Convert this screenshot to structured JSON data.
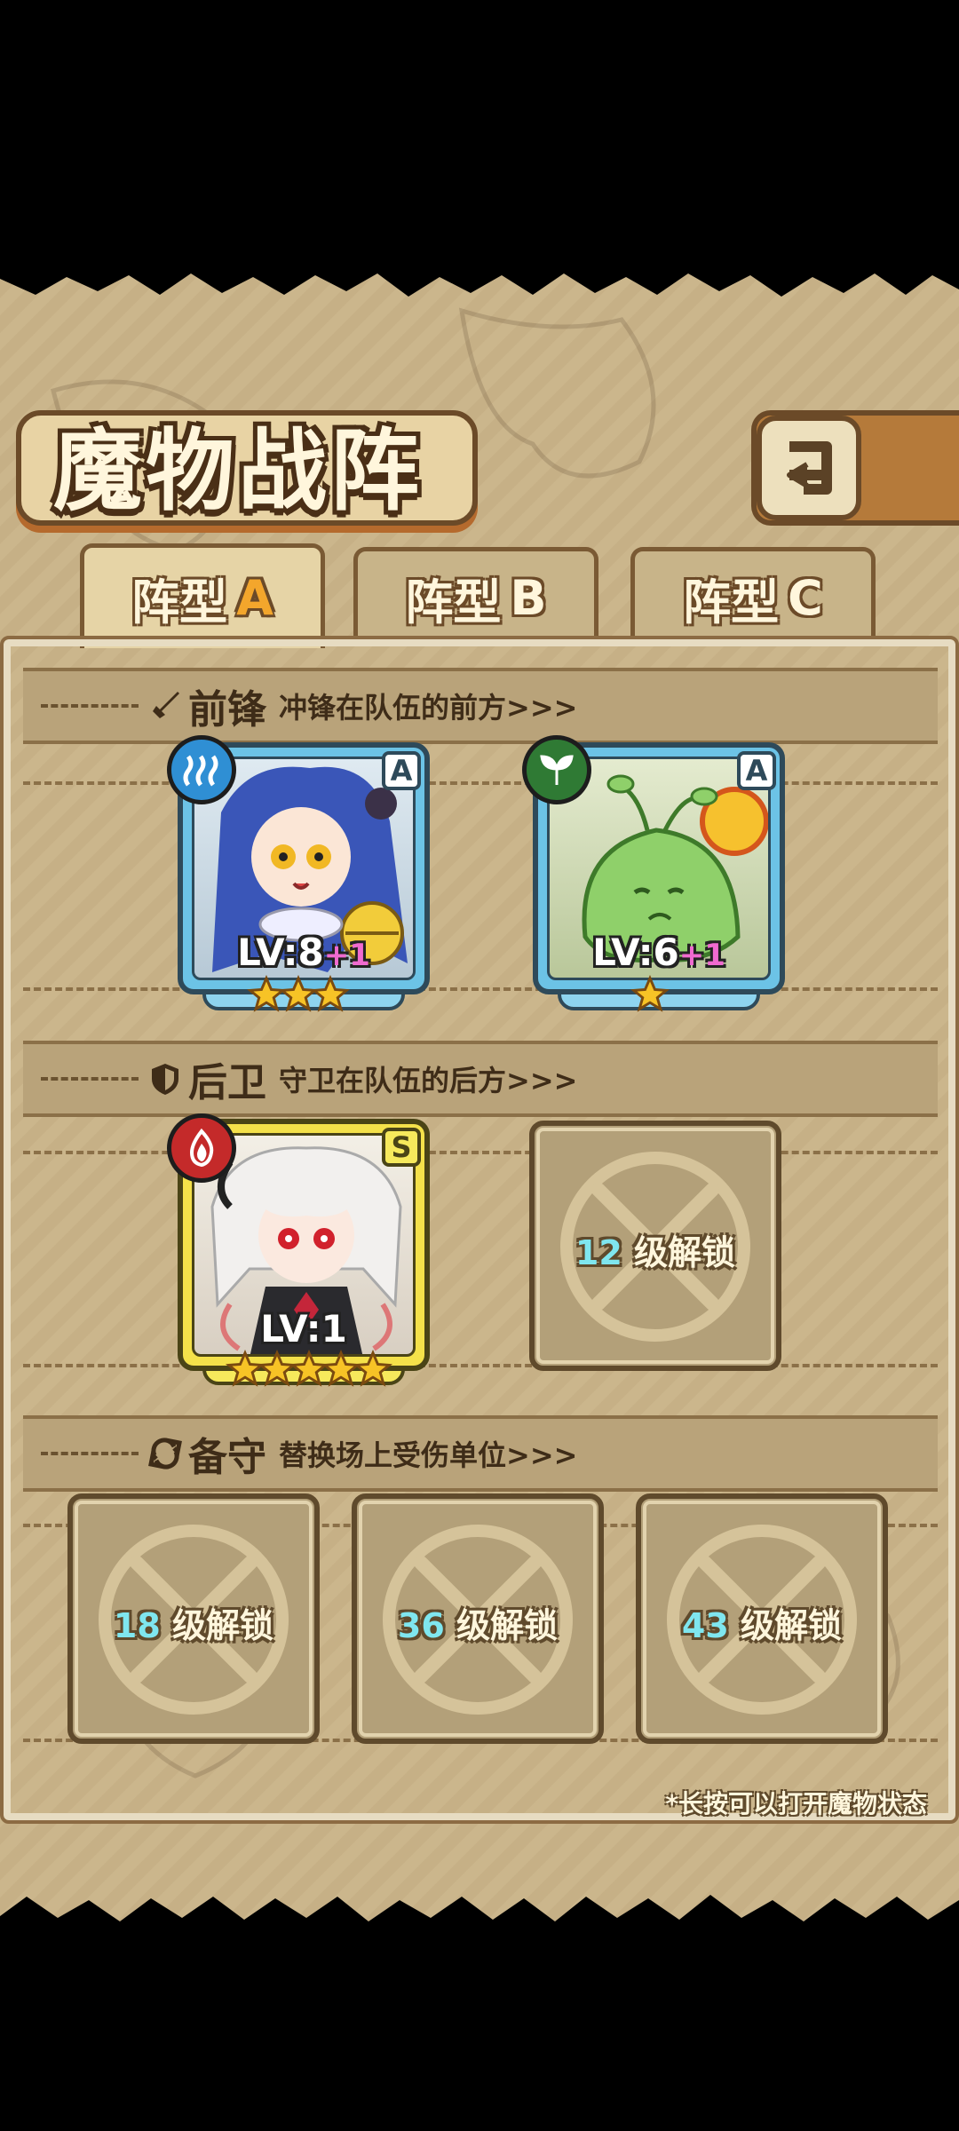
{
  "title": "魔物战阵",
  "tabs": [
    {
      "label": "阵型",
      "letter": "A",
      "active": true
    },
    {
      "label": "阵型",
      "letter": "B",
      "active": false
    },
    {
      "label": "阵型",
      "letter": "C",
      "active": false
    }
  ],
  "sections": {
    "vanguard": {
      "name": "前锋",
      "desc": "冲锋在队伍的前方>>>",
      "icon": "sword-icon"
    },
    "rearguard": {
      "name": "后卫",
      "desc": "守卫在队伍的后方>>>",
      "icon": "shield-icon"
    },
    "reserve": {
      "name": "备守",
      "desc": "替换场上受伤单位>>>",
      "icon": "swap-icon"
    }
  },
  "monsters": [
    {
      "slot": "vanguard",
      "element": "water-icon",
      "element_color": "#2f8fd4",
      "rank": "A",
      "level_text": "LV:8",
      "bonus": "+1",
      "stars": 3,
      "frame_color": "#6cc3e6",
      "portrait": "blue-haired-cat-girl"
    },
    {
      "slot": "vanguard",
      "element": "leaf-icon",
      "element_color": "#2f7a34",
      "rank": "A",
      "level_text": "LV:6",
      "bonus": "+1",
      "stars": 1,
      "frame_color": "#6cc3e6",
      "portrait": "green-slime-mushroom"
    },
    {
      "slot": "rearguard",
      "element": "fire-icon",
      "element_color": "#c42a2a",
      "rank": "S",
      "level_text": "LV:1",
      "bonus": "",
      "stars": 5,
      "frame_color": "#f4e14a",
      "portrait": "white-haired-demon-girl"
    }
  ],
  "locked_slots": [
    {
      "slot": "rearguard",
      "level": "12",
      "text": "级解锁"
    },
    {
      "slot": "reserve",
      "level": "18",
      "text": "级解锁"
    },
    {
      "slot": "reserve",
      "level": "36",
      "text": "级解锁"
    },
    {
      "slot": "reserve",
      "level": "43",
      "text": "级解锁"
    }
  ],
  "hint": "*长按可以打开魔物状态",
  "colors": {
    "panel": "#cbb68c",
    "accent": "#f3a62c",
    "lock_number": "#7fe6ef",
    "bonus": "#f06ad0"
  }
}
